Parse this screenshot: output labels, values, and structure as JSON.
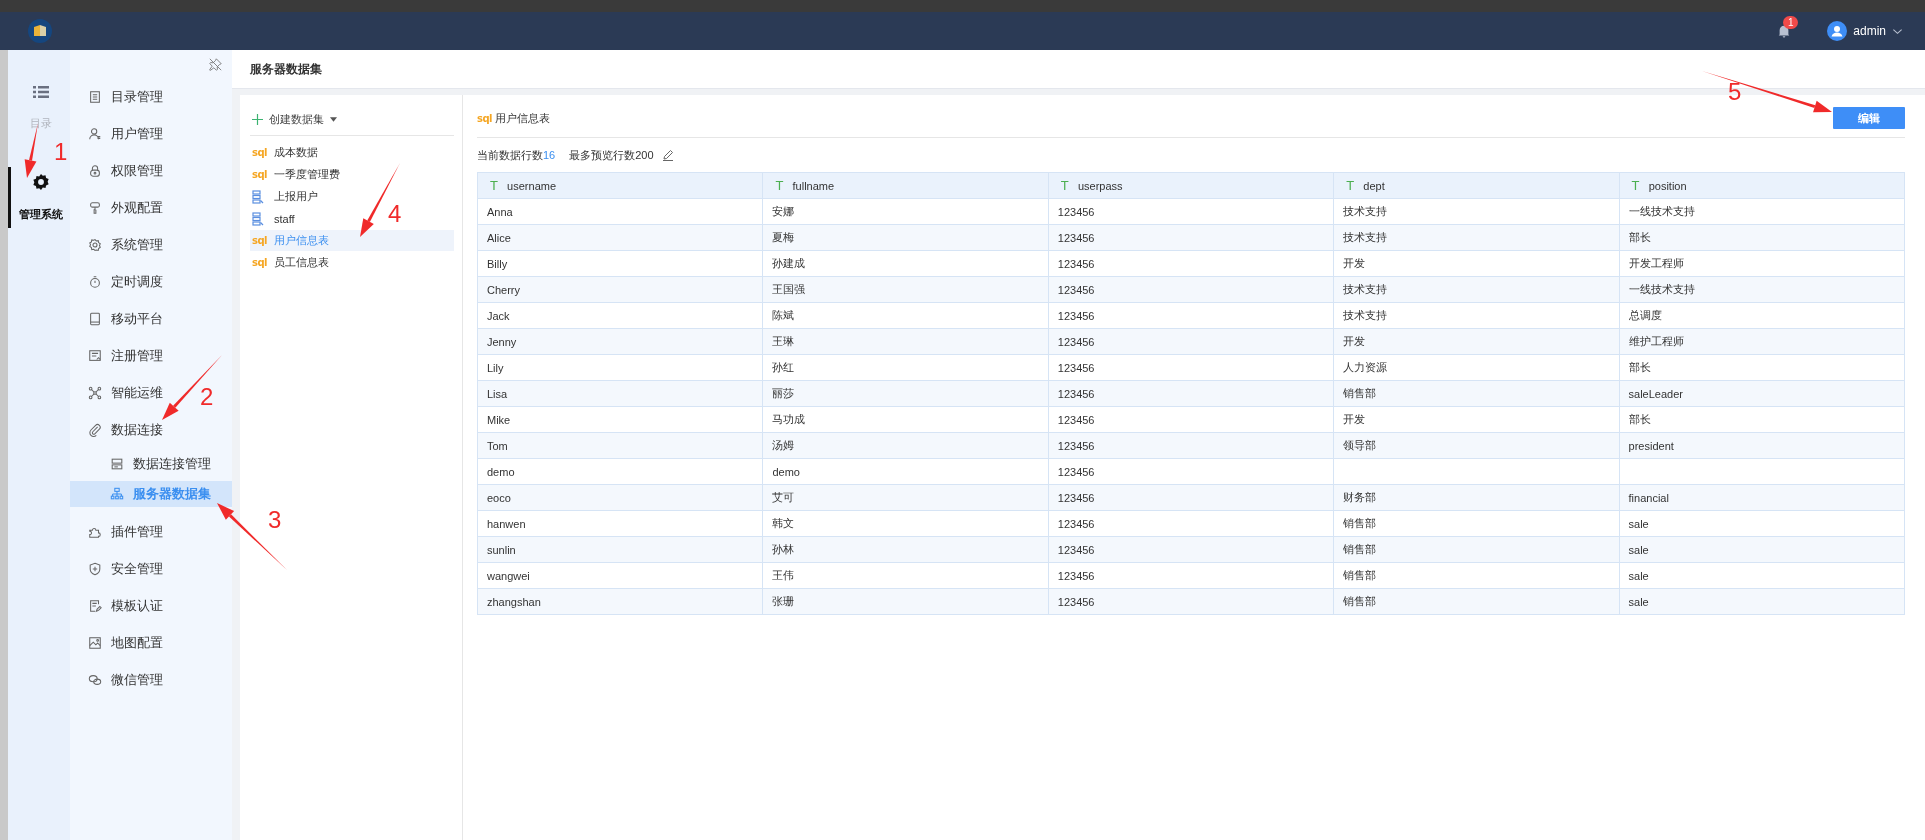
{
  "header": {
    "user": "admin",
    "notifications": "1"
  },
  "rail": [
    {
      "label": "目录",
      "selected": false
    },
    {
      "label": "管理系统",
      "selected": true
    }
  ],
  "nav": [
    {
      "label": "目录管理",
      "selected": false
    },
    {
      "label": "用户管理",
      "selected": false
    },
    {
      "label": "权限管理",
      "selected": false
    },
    {
      "label": "外观配置",
      "selected": false
    },
    {
      "label": "系统管理",
      "selected": false
    },
    {
      "label": "定时调度",
      "selected": false
    },
    {
      "label": "移动平台",
      "selected": false
    },
    {
      "label": "注册管理",
      "selected": false
    },
    {
      "label": "智能运维",
      "selected": false
    },
    {
      "label": "数据连接",
      "selected": false,
      "children": [
        {
          "label": "数据连接管理",
          "selected": false
        },
        {
          "label": "服务器数据集",
          "selected": true
        }
      ]
    },
    {
      "label": "插件管理",
      "selected": false
    },
    {
      "label": "安全管理",
      "selected": false
    },
    {
      "label": "模板认证",
      "selected": false
    },
    {
      "label": "地图配置",
      "selected": false
    },
    {
      "label": "微信管理",
      "selected": false
    }
  ],
  "page_title": "服务器数据集",
  "tree": {
    "create": "创建数据集",
    "items": [
      {
        "kind": "sql",
        "badge": "sql",
        "label": "成本数据",
        "selected": false
      },
      {
        "kind": "sql",
        "badge": "sql",
        "label": "一季度管理费",
        "selected": false
      },
      {
        "kind": "table",
        "label": "上报用户",
        "selected": false
      },
      {
        "kind": "table",
        "label": "staff",
        "selected": false
      },
      {
        "kind": "sql",
        "badge": "sql",
        "label": "用户信息表",
        "selected": true
      },
      {
        "kind": "sql",
        "badge": "sql",
        "label": "员工信息表",
        "selected": false
      }
    ]
  },
  "preview": {
    "badge": "sql",
    "title": "用户信息表",
    "edit_button": "编辑",
    "row_count_label": "当前数据行数",
    "row_count": "16",
    "max_preview": "最多预览行数200",
    "table": {
      "columns": [
        {
          "type_mark": "T",
          "name": "username"
        },
        {
          "type_mark": "T",
          "name": "fullname"
        },
        {
          "type_mark": "T",
          "name": "userpass"
        },
        {
          "type_mark": "T",
          "name": "dept"
        },
        {
          "type_mark": "T",
          "name": "position"
        }
      ],
      "rows": [
        [
          "Anna",
          "安娜",
          "123456",
          "技术支持",
          "一线技术支持"
        ],
        [
          "Alice",
          "夏梅",
          "123456",
          "技术支持",
          "部长"
        ],
        [
          "Billy",
          "孙建成",
          "123456",
          "开发",
          "开发工程师"
        ],
        [
          "Cherry",
          "王国强",
          "123456",
          "技术支持",
          "一线技术支持"
        ],
        [
          "Jack",
          "陈斌",
          "123456",
          "技术支持",
          "总调度"
        ],
        [
          "Jenny",
          "王琳",
          "123456",
          "开发",
          "维护工程师"
        ],
        [
          "Lily",
          "孙红",
          "123456",
          "人力资源",
          "部长"
        ],
        [
          "Lisa",
          "丽莎",
          "123456",
          "销售部",
          "saleLeader"
        ],
        [
          "Mike",
          "马功成",
          "123456",
          "开发",
          "部长"
        ],
        [
          "Tom",
          "汤姆",
          "123456",
          "领导部",
          "president"
        ],
        [
          "demo",
          "demo",
          "123456",
          "",
          ""
        ],
        [
          "eoco",
          "艾可",
          "123456",
          "财务部",
          "financial"
        ],
        [
          "hanwen",
          "韩文",
          "123456",
          "销售部",
          "sale"
        ],
        [
          "sunlin",
          "孙林",
          "123456",
          "销售部",
          "sale"
        ],
        [
          "wangwei",
          "王伟",
          "123456",
          "销售部",
          "sale"
        ],
        [
          "zhangshan",
          "张珊",
          "123456",
          "销售部",
          "sale"
        ]
      ]
    }
  },
  "annotations": [
    {
      "label": "1"
    },
    {
      "label": "2"
    },
    {
      "label": "3"
    },
    {
      "label": "4"
    },
    {
      "label": "5"
    }
  ]
}
